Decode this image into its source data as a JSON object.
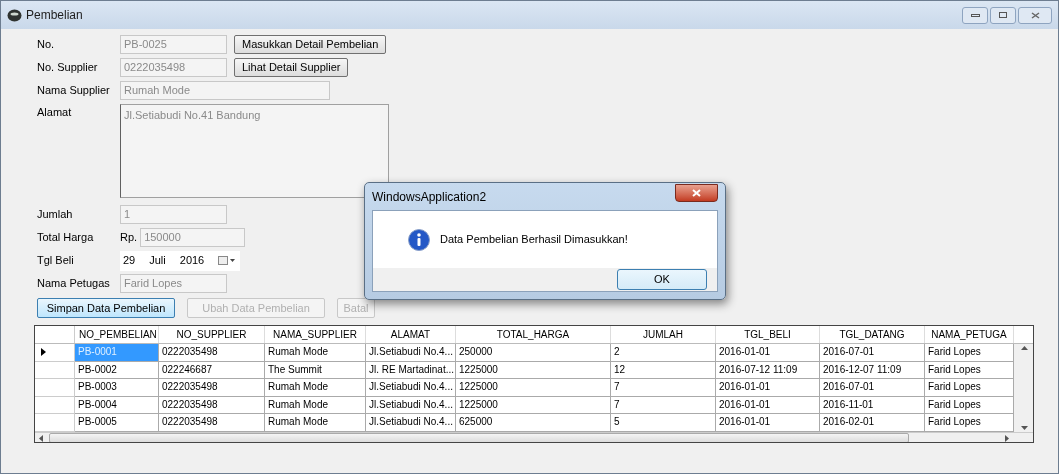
{
  "window": {
    "title": "Pembelian"
  },
  "form": {
    "fields": [
      {
        "kind": "text",
        "label": "No.",
        "value": "PB-0025",
        "button": "Masukkan Detail Pembelian"
      },
      {
        "kind": "text",
        "label": "No. Supplier",
        "value": "0222035498",
        "button": "Lihat Detail Supplier"
      },
      {
        "kind": "wide",
        "label": "Nama Supplier",
        "value": "Rumah Mode"
      },
      {
        "kind": "area",
        "label": "Alamat",
        "value": "Jl.Setiabudi No.41 Bandung"
      },
      {
        "kind": "text",
        "label": "Jumlah",
        "value": "1"
      },
      {
        "kind": "prefix",
        "label": "Total Harga",
        "prefix": "Rp.",
        "value": "150000"
      },
      {
        "kind": "date",
        "label": "Tgl Beli",
        "day": "29",
        "month": "Juli",
        "year": "2016"
      },
      {
        "kind": "text",
        "label": "Nama Petugas",
        "value": "Farid Lopes"
      }
    ],
    "buttons": [
      {
        "label": "Simpan Data Pembelian",
        "disabled": false
      },
      {
        "label": "Ubah Data Pembelian",
        "disabled": true
      },
      {
        "label": "Batal",
        "disabled": true
      }
    ]
  },
  "table": {
    "columns": [
      "NO_PEMBELIAN",
      "NO_SUPPLIER",
      "NAMA_SUPPLIER",
      "ALAMAT",
      "TOTAL_HARGA",
      "JUMLAH",
      "TGL_BELI",
      "TGL_DATANG",
      "NAMA_PETUGA"
    ],
    "rows": [
      {
        "selected": true,
        "cells": [
          "PB-0001",
          "0222035498",
          "Rumah Mode",
          "Jl.Setiabudi No.4...",
          "250000",
          "2",
          "2016-01-01",
          "2016-07-01",
          "Farid Lopes"
        ]
      },
      {
        "selected": false,
        "cells": [
          "PB-0002",
          "022246687",
          "The Summit",
          "Jl. RE Martadinat...",
          "1225000",
          "12",
          "2016-07-12 11:09",
          "2016-12-07 11:09",
          "Farid Lopes"
        ]
      },
      {
        "selected": false,
        "cells": [
          "PB-0003",
          "0222035498",
          "Rumah Mode",
          "Jl.Setiabudi No.4...",
          "1225000",
          "7",
          "2016-01-01",
          "2016-07-01",
          "Farid Lopes"
        ]
      },
      {
        "selected": false,
        "cells": [
          "PB-0004",
          "0222035498",
          "Rumah Mode",
          "Jl.Setiabudi No.4...",
          "1225000",
          "7",
          "2016-01-01",
          "2016-11-01",
          "Farid Lopes"
        ]
      },
      {
        "selected": false,
        "cells": [
          "PB-0005",
          "0222035498",
          "Rumah Mode",
          "Jl.Setiabudi No.4...",
          "625000",
          "5",
          "2016-01-01",
          "2016-02-01",
          "Farid Lopes"
        ]
      }
    ]
  },
  "dialog": {
    "title": "WindowsApplication2",
    "message": "Data Pembelian Berhasil Dimasukkan!",
    "button": "OK"
  }
}
